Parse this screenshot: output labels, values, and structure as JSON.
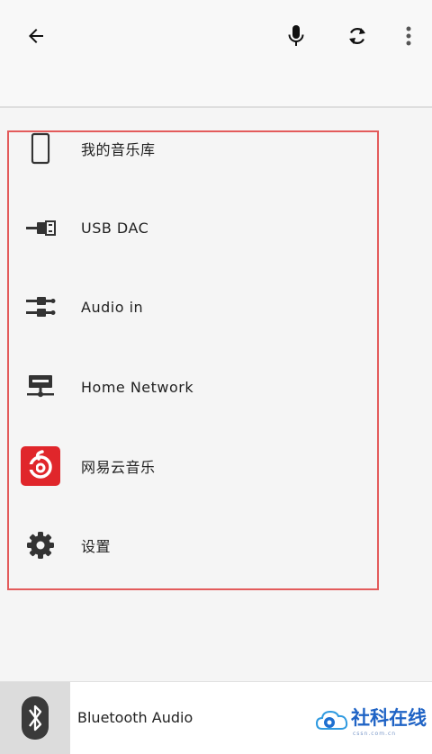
{
  "toolbar": {
    "back_icon": "arrow-left-icon",
    "mic_icon": "microphone-icon",
    "refresh_icon": "sync-icon",
    "more_icon": "more-vertical-icon"
  },
  "menu": {
    "items": [
      {
        "label": "我的音乐库",
        "icon": "phone-icon"
      },
      {
        "label": "USB DAC",
        "icon": "usb-icon"
      },
      {
        "label": "Audio in",
        "icon": "audio-jack-icon"
      },
      {
        "label": "Home Network",
        "icon": "network-icon"
      },
      {
        "label": "网易云音乐",
        "icon": "netease-music-icon"
      },
      {
        "label": "设置",
        "icon": "gear-icon"
      }
    ]
  },
  "bottom_bar": {
    "label": "Bluetooth Audio",
    "icon": "bluetooth-icon"
  },
  "watermark": {
    "text": "社科在线",
    "url": "cssn.com.cn"
  },
  "colors": {
    "highlight_border": "#e35b5b",
    "netease_red": "#e0262b",
    "icon_dark": "#333333",
    "watermark_blue": "#1f63c5"
  }
}
